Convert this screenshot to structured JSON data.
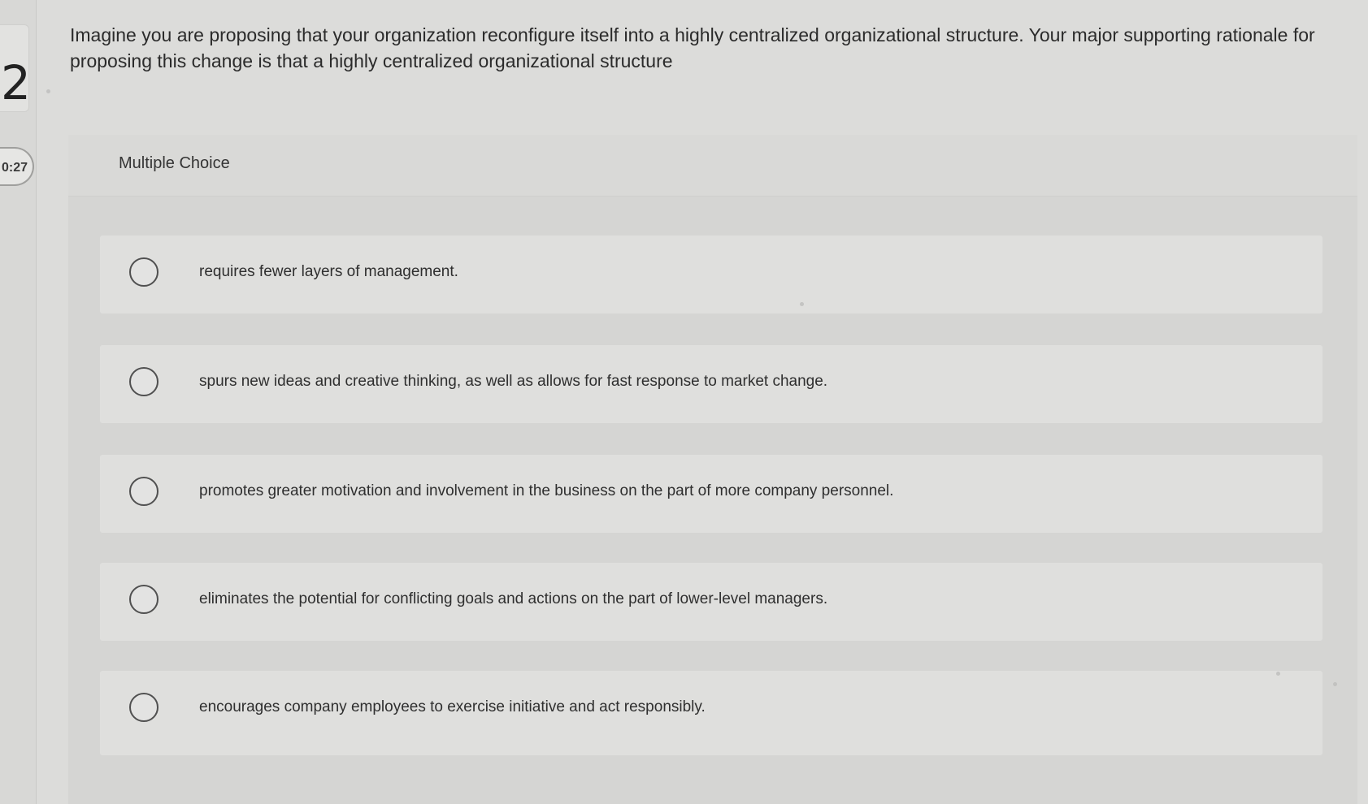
{
  "sidebar": {
    "question_number": "2",
    "timer": "0:27"
  },
  "question": {
    "text": "Imagine you are proposing that your organization reconfigure itself into a highly centralized organizational structure. Your major supporting rationale for proposing this change is that a highly centralized organizational structure"
  },
  "choice_panel": {
    "title": "Multiple Choice",
    "options": [
      {
        "label": "requires fewer layers of management."
      },
      {
        "label": "spurs new ideas and creative thinking, as well as allows for fast response to market change."
      },
      {
        "label": "promotes greater motivation and involvement in the business on the part of more company personnel."
      },
      {
        "label": "eliminates the potential for conflicting goals and actions on the part of lower-level managers."
      },
      {
        "label": "encourages company employees to exercise initiative and act responsibly."
      }
    ]
  }
}
